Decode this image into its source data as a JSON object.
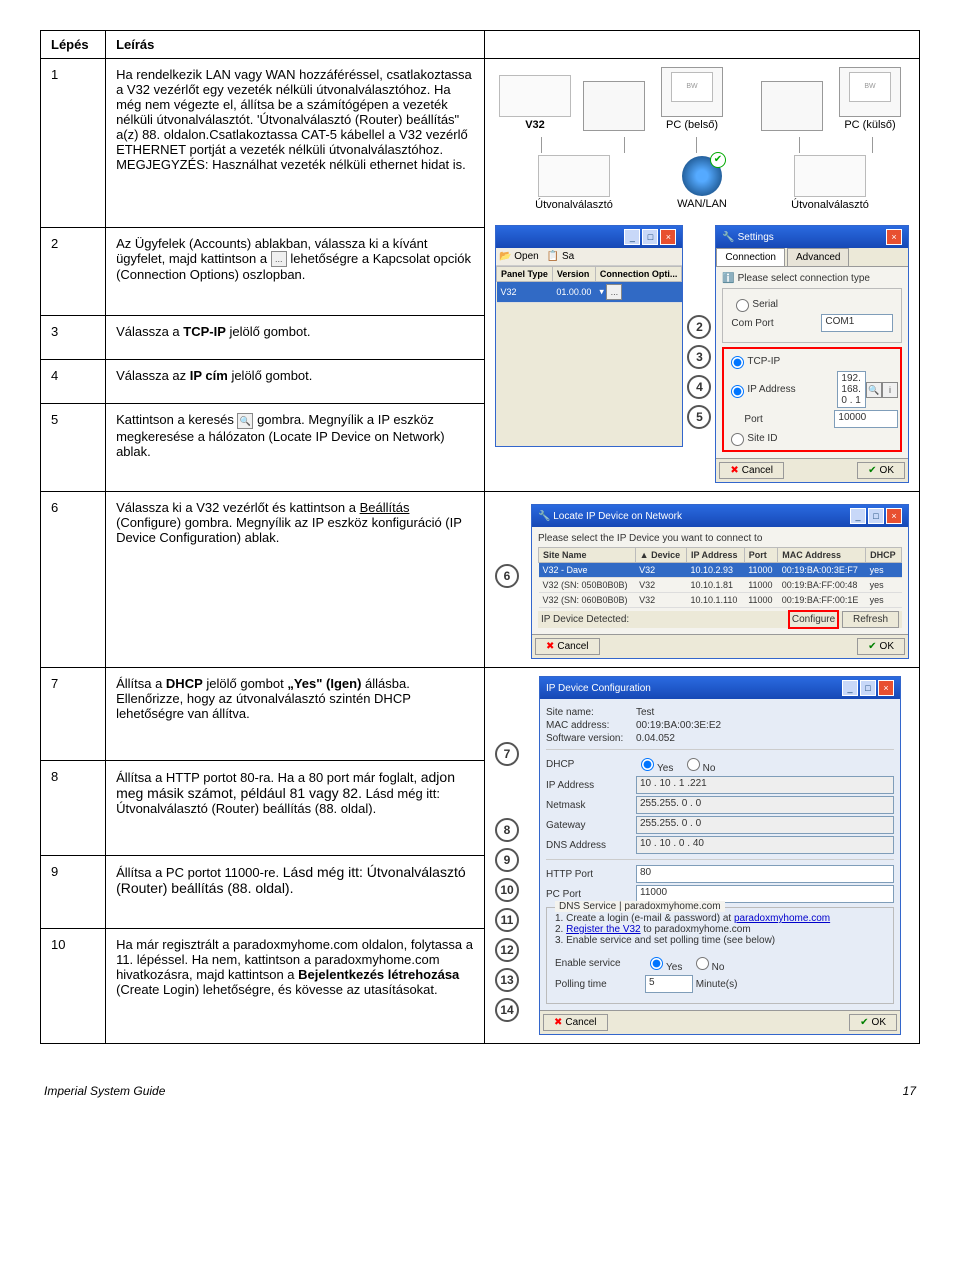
{
  "header": {
    "step_col": "Lépés",
    "desc_col": "Leírás"
  },
  "steps": {
    "s1": {
      "n": "1",
      "text": "Ha rendelkezik LAN vagy WAN hozzáféréssel, csatlakoztassa a V32 vezérlőt egy vezeték nélküli útvonalválasztóhoz. Ha még nem végezte el, állítsa be a számítógépen a vezeték nélküli útvonalválasztót. 'Útvonalválasztó (Router) beállítás\" a(z) 88. oldalon.Csatlakoztassa CAT-5 kábellel a V32 vezérlő ETHERNET portját a vezeték nélküli útvonalválasztóhoz. MEGJEGYZÉS: Használhat vezeték nélküli ethernet hidat is."
    },
    "s2": {
      "n": "2",
      "pre": "Az Ügyfelek (Accounts) ablakban, válassza ki a kívánt ügyfelet, majd kattintson a ",
      "post": " lehetőségre a Kapcsolat opciók (Connection Options) oszlopban."
    },
    "s3": {
      "n": "3",
      "text": "Válassza a ",
      "b": "TCP-IP",
      "after": " jelölő gombot."
    },
    "s4": {
      "n": "4",
      "text": "Válassza az ",
      "b": "IP cím",
      "after": " jelölő gombot."
    },
    "s5": {
      "n": "5",
      "pre": "Kattintson a keresés ",
      "post": " gombra. Megnyílik a IP eszköz megkeresése a hálózaton (Locate IP Device on Network) ablak."
    },
    "s6": {
      "n": "6",
      "pre": "Válassza ki a V32 vezérlőt és kattintson a ",
      "u": "Beállítás",
      "post": " (Configure) gombra. Megnyílik az IP eszköz konfiguráció (IP Device Configuration) ablak."
    },
    "s7": {
      "n": "7",
      "pre": "Állítsa a ",
      "b": "DHCP",
      "mid": " jelölő gombot ",
      "b2": "„Yes\" (Igen)",
      "post": " állásba. Ellenőrizze, hogy az útvonalválasztó szintén DHCP lehetőségre van állítva."
    },
    "s8": {
      "n": "8",
      "pre": "Állítsa a HTTP portot 80-ra. Ha a 80 port már foglalt, ",
      "mid": "adjon meg másik számot, például 81 vagy 82.",
      "post": " Lásd még itt: Útvonalválasztó (Router) beállítás (88. oldal)."
    },
    "s9": {
      "n": "9",
      "pre": "Állítsa a PC portot 11000-re. ",
      "post": "Lásd még itt: Útvonalválasztó (Router) beállítás (88. oldal)."
    },
    "s10": {
      "n": "10",
      "pre": "Ha már regisztrált a paradoxmyhome.com oldalon, folytassa a 11. lépéssel. Ha nem, kattintson a paradoxmyhome.com hivatkozásra, majd kattintson a ",
      "b": "Bejelentkezés létrehozása",
      "post": " (Create Login) lehetőségre, és kövesse az utasításokat."
    }
  },
  "diagram": {
    "v32": "V32",
    "bw": "BW",
    "pc_inner": "PC (belső)",
    "pc_outer": "PC (külső)",
    "router1": "Útvonalválasztó",
    "wan": "WAN/LAN",
    "router2": "Útvonalválasztó"
  },
  "settings_win": {
    "title": "Settings",
    "tab_conn": "Connection",
    "tab_adv": "Advanced",
    "please": "Please select connection type",
    "serial": "Serial",
    "comport": "Com Port",
    "com_val": "COM1",
    "tcpip": "TCP-IP",
    "ipaddr": "IP Address",
    "ip_val": "192. 168. 0 . 1",
    "port": "Port",
    "port_val": "10000",
    "siteid": "Site ID",
    "open": "Open",
    "sa": "Sa",
    "panel_type": "Panel Type",
    "version": "Version",
    "conn_opt": "Connection Opti...",
    "row_panel": "V32",
    "row_ver": "01.00.00",
    "cancel": "Cancel",
    "ok": "OK"
  },
  "locate_win": {
    "title": "Locate IP Device on Network",
    "please": "Please select the IP Device you want to connect to",
    "cols": {
      "site": "Site Name",
      "dev": "Device",
      "ip": "IP Address",
      "port": "Port",
      "mac": "MAC Address",
      "dhcp": "DHCP"
    },
    "rows": [
      {
        "site": "V32 - Dave",
        "dev": "V32",
        "ip": "10.10.2.93",
        "port": "11000",
        "mac": "00:19:BA:00:3E:F7",
        "dhcp": "yes"
      },
      {
        "site": "V32 (SN: 050B0B0B)",
        "dev": "V32",
        "ip": "10.10.1.81",
        "port": "11000",
        "mac": "00:19:BA:FF:00:48",
        "dhcp": "yes"
      },
      {
        "site": "V32 (SN: 060B0B0B)",
        "dev": "V32",
        "ip": "10.10.1.110",
        "port": "11000",
        "mac": "00:19:BA:FF:00:1E",
        "dhcp": "yes"
      }
    ],
    "detected": "IP Device Detected:",
    "configure": "Configure",
    "refresh": "Refresh",
    "cancel": "Cancel",
    "ok": "OK"
  },
  "config_win": {
    "title": "IP Device Configuration",
    "site": "Site name:",
    "site_val": "Test",
    "mac": "MAC address:",
    "mac_val": "00:19:BA:00:3E:E2",
    "sw": "Software version:",
    "sw_val": "0.04.052",
    "dhcp": "DHCP",
    "yes": "Yes",
    "no": "No",
    "ipaddr": "IP Address",
    "ip_val": "10 . 10 . 1 .221",
    "netmask": "Netmask",
    "nm_val": "255.255.  0 .  0",
    "gateway": "Gateway",
    "gw_val": "255.255.  0 .  0",
    "dns": "DNS Address",
    "dns_val": "10 . 10 . 0 . 40",
    "http": "HTTP Port",
    "http_val": "80",
    "pcport": "PC Port",
    "pc_val": "11000",
    "dnssvc": "DNS Service | paradoxmyhome.com",
    "step1_a": "1. Create a login (e-mail & password) at ",
    "step1_b": "paradoxmyhome.com",
    "step2_a": "2. ",
    "step2_b": "Register the V32",
    "step2_c": " to paradoxmyhome.com",
    "step3": "3. Enable service and set polling time (see below)",
    "enable": "Enable service",
    "poll": "Polling time",
    "poll_val": "5",
    "poll_unit": "Minute(s)",
    "cancel": "Cancel",
    "ok": "OK"
  },
  "callouts": {
    "c2": "2",
    "c3": "3",
    "c4": "4",
    "c5": "5",
    "c6": "6",
    "c7": "7",
    "c8": "8",
    "c9": "9",
    "c10": "10",
    "c11": "11",
    "c12": "12",
    "c13": "13",
    "c14": "14"
  },
  "footer": {
    "left": "Imperial System Guide",
    "right": "17"
  }
}
